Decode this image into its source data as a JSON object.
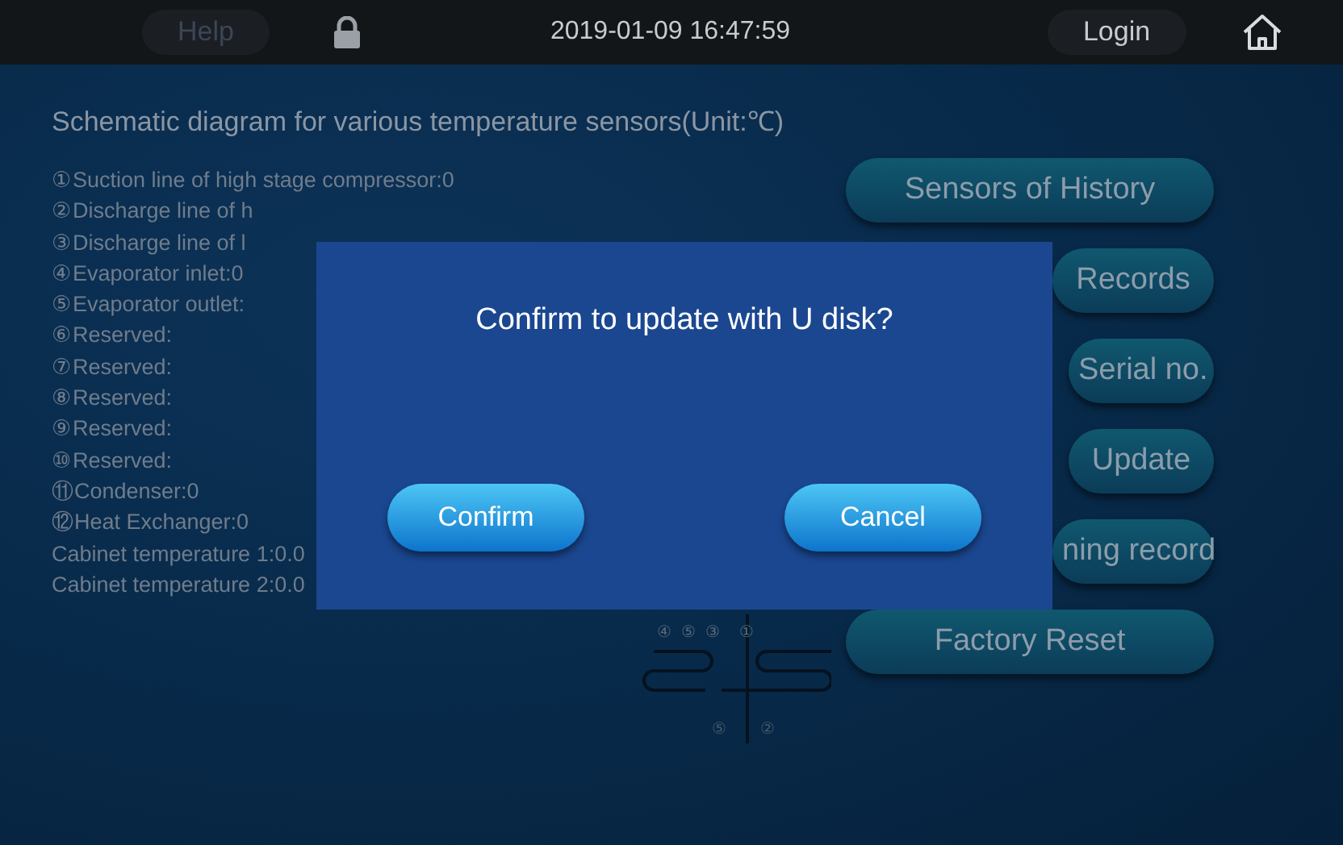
{
  "top_bar": {
    "help": "Help",
    "datetime": "2019-01-09 16:47:59",
    "login": "Login"
  },
  "title": "Schematic diagram for various temperature sensors(Unit:℃)",
  "sensors": [
    "①Suction line of high stage compressor:0",
    "②Discharge line of h",
    "③Discharge line of l",
    "④Evaporator inlet:0",
    "⑤Evaporator outlet:",
    "⑥Reserved:",
    "⑦Reserved:",
    "⑧Reserved:",
    "⑨Reserved:",
    "⑩Reserved:",
    "⑪Condenser:0",
    "⑫Heat Exchanger:0",
    "Cabinet temperature 1:0.0",
    "Cabinet temperature 2:0.0"
  ],
  "menu_buttons": [
    {
      "label": "Sensors of History",
      "kind": "full"
    },
    {
      "label": "Records",
      "kind": "partial"
    },
    {
      "label": "Serial no.",
      "kind": "short"
    },
    {
      "label": "Update",
      "kind": "short"
    },
    {
      "label": "ning record",
      "kind": "partial"
    },
    {
      "label": "Factory Reset",
      "kind": "full"
    }
  ],
  "diagram": {
    "top_labels": [
      "④",
      "⑤",
      "③",
      "①"
    ],
    "bottom_labels": [
      "⑤",
      "②"
    ]
  },
  "dialog": {
    "message": "Confirm to update with U disk?",
    "buttons": [
      "Confirm",
      "Cancel"
    ]
  }
}
